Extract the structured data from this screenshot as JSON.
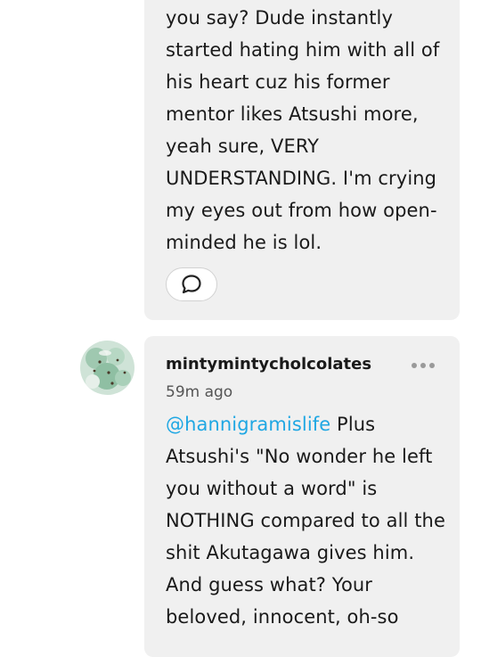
{
  "comments": [
    {
      "text": "you say? Dude instantly started hating him with all of his heart cuz his former mentor likes Atsushi more, yeah sure, VERY UNDERSTANDING. I'm crying my eyes out from how open-minded he is lol.",
      "reply_icon": "speech-bubble-icon"
    },
    {
      "username": "mintymintycholcolates",
      "timestamp": "59m ago",
      "mention": "@hannigramislife",
      "text": " Plus Atsushi's \"No wonder he left you without a word\" is NOTHING compared to all the shit Akutagawa gives him. And guess what? Your beloved, innocent, oh-so",
      "menu_icon": "more-dots-icon",
      "avatar_icon": "avatar-image"
    }
  ],
  "colors": {
    "card_background": "#f0f0f0",
    "mention": "#1fa7e3"
  }
}
